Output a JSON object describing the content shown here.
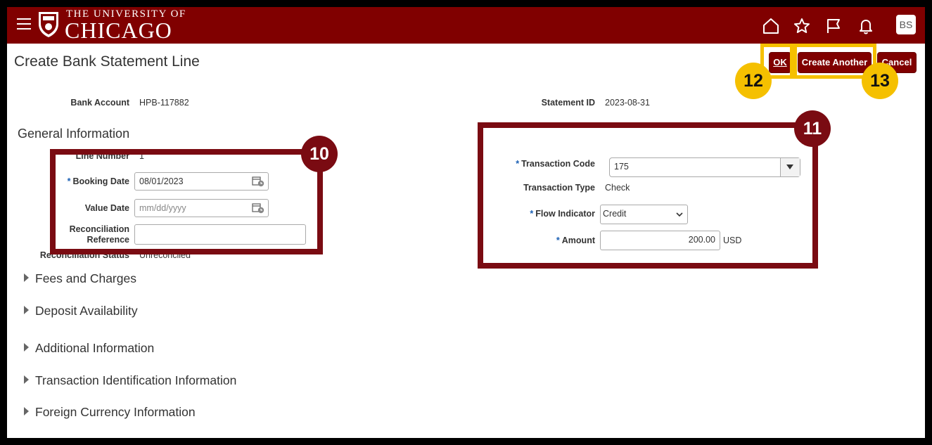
{
  "header": {
    "logo_line1": "THE UNIVERSITY OF",
    "logo_line2": "CHICAGO",
    "avatar_initials": "BS",
    "icons": [
      "home-icon",
      "star-icon",
      "flag-icon",
      "bell-icon"
    ]
  },
  "page": {
    "title": "Create Bank Statement Line",
    "buttons": {
      "ok": "OK",
      "create_another": "Create Another",
      "cancel": "Cancel"
    }
  },
  "summary": {
    "bank_account_label": "Bank Account",
    "bank_account_value": "HPB-117882",
    "statement_id_label": "Statement ID",
    "statement_id_value": "2023-08-31"
  },
  "general": {
    "heading": "General Information",
    "line_number_label": "Line Number",
    "line_number_value": "1",
    "booking_date_label": "Booking Date",
    "booking_date_value": "08/01/2023",
    "value_date_label": "Value Date",
    "value_date_placeholder": "mm/dd/yyyy",
    "reconciliation_reference_label_1": "Reconciliation",
    "reconciliation_reference_label_2": "Reference",
    "reconciliation_reference_value": "",
    "reconciliation_status_label": "Reconciliation Status",
    "reconciliation_status_value": "Unreconciled"
  },
  "transaction": {
    "code_label": "Transaction Code",
    "code_value": "175",
    "type_label": "Transaction Type",
    "type_value": "Check",
    "flow_label": "Flow Indicator",
    "flow_value": "Credit",
    "amount_label": "Amount",
    "amount_value": "200.00",
    "currency": "USD"
  },
  "sections": [
    "Fees and Charges",
    "Deposit Availability",
    "Additional Information",
    "Transaction Identification Information",
    "Foreign Currency Information"
  ],
  "callouts": {
    "c10": "10",
    "c11": "11",
    "c12": "12",
    "c13": "13"
  },
  "colors": {
    "brand": "#800000",
    "callout_dark": "#7a0b12",
    "callout_yellow": "#f5c000",
    "required": "#1a5fb4"
  }
}
